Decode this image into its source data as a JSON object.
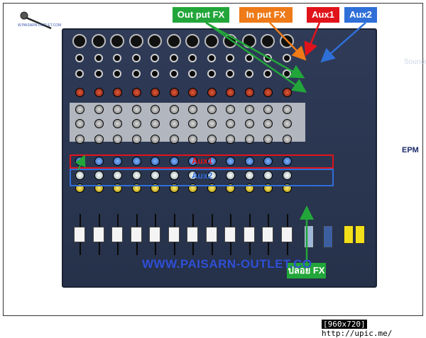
{
  "labels": {
    "output_fx": "Out put FX",
    "input_fx": "In put FX",
    "aux1": "Aux1",
    "aux2": "Aux2",
    "pla_fx": "ปล่อย FX",
    "aux1_overlay": "Aux1",
    "aux2_overlay": "Aux2"
  },
  "watermark": "WWW.PAISARN-OUTLET.CO",
  "logo_text": "W.PAISARN-OUTLET.COM",
  "brand": "Soundcraft",
  "model": "EPM",
  "footer": {
    "resolution": "[960x720]",
    "url": "http://upic.me/"
  },
  "colors": {
    "output_fx": "#22a63a",
    "input_fx": "#ee7a18",
    "aux1": "#e0131b",
    "aux2": "#2f6fd8"
  },
  "channel_count": 12
}
